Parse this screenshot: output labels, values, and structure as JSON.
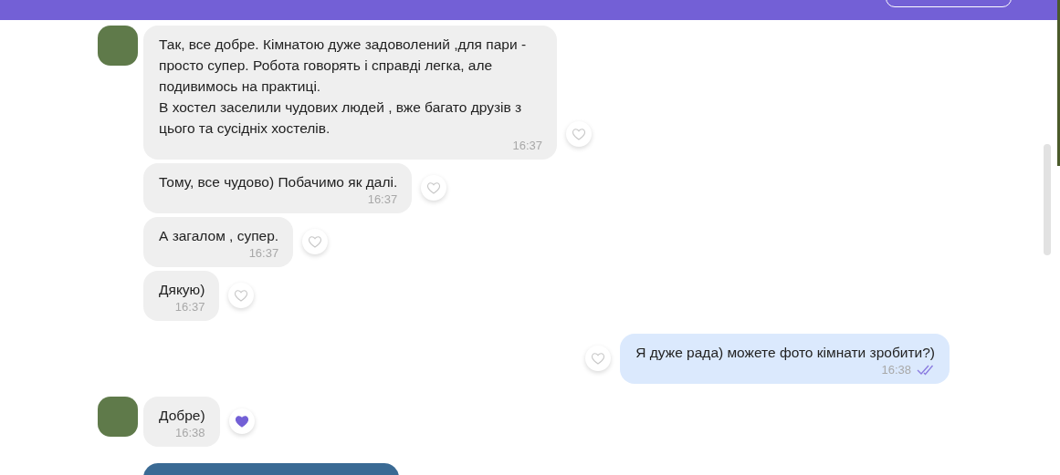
{
  "messages": [
    {
      "kind": "text",
      "incoming": true,
      "avatar": true,
      "text": "Так, все добре. Кімнатою дуже задоволений ,для пари - просто супер. Робота говорять і справді легка, але подивимось на практиці.\nВ хостел заселили чудових людей , вже багато друзів з цього та сусідніх хостелів.",
      "time": "16:37",
      "liked": false
    },
    {
      "kind": "text",
      "incoming": true,
      "avatar": false,
      "text": "Тому, все чудово) Побачимо як далі.",
      "time": "16:37",
      "liked": false
    },
    {
      "kind": "text",
      "incoming": true,
      "avatar": false,
      "text": "А загалом , супер.",
      "time": "16:37",
      "liked": false
    },
    {
      "kind": "text",
      "incoming": true,
      "avatar": false,
      "text": "Дякую)",
      "time": "16:37",
      "liked": false
    },
    {
      "kind": "text",
      "incoming": false,
      "avatar": false,
      "text": "Я дуже рада) можете фото кімнати зробити?)",
      "time": "16:38",
      "liked": false,
      "read": true
    },
    {
      "kind": "text",
      "incoming": true,
      "avatar": true,
      "text": "Добре)",
      "time": "16:38",
      "liked": true
    },
    {
      "kind": "photo",
      "incoming": true,
      "avatar": false
    }
  ]
}
